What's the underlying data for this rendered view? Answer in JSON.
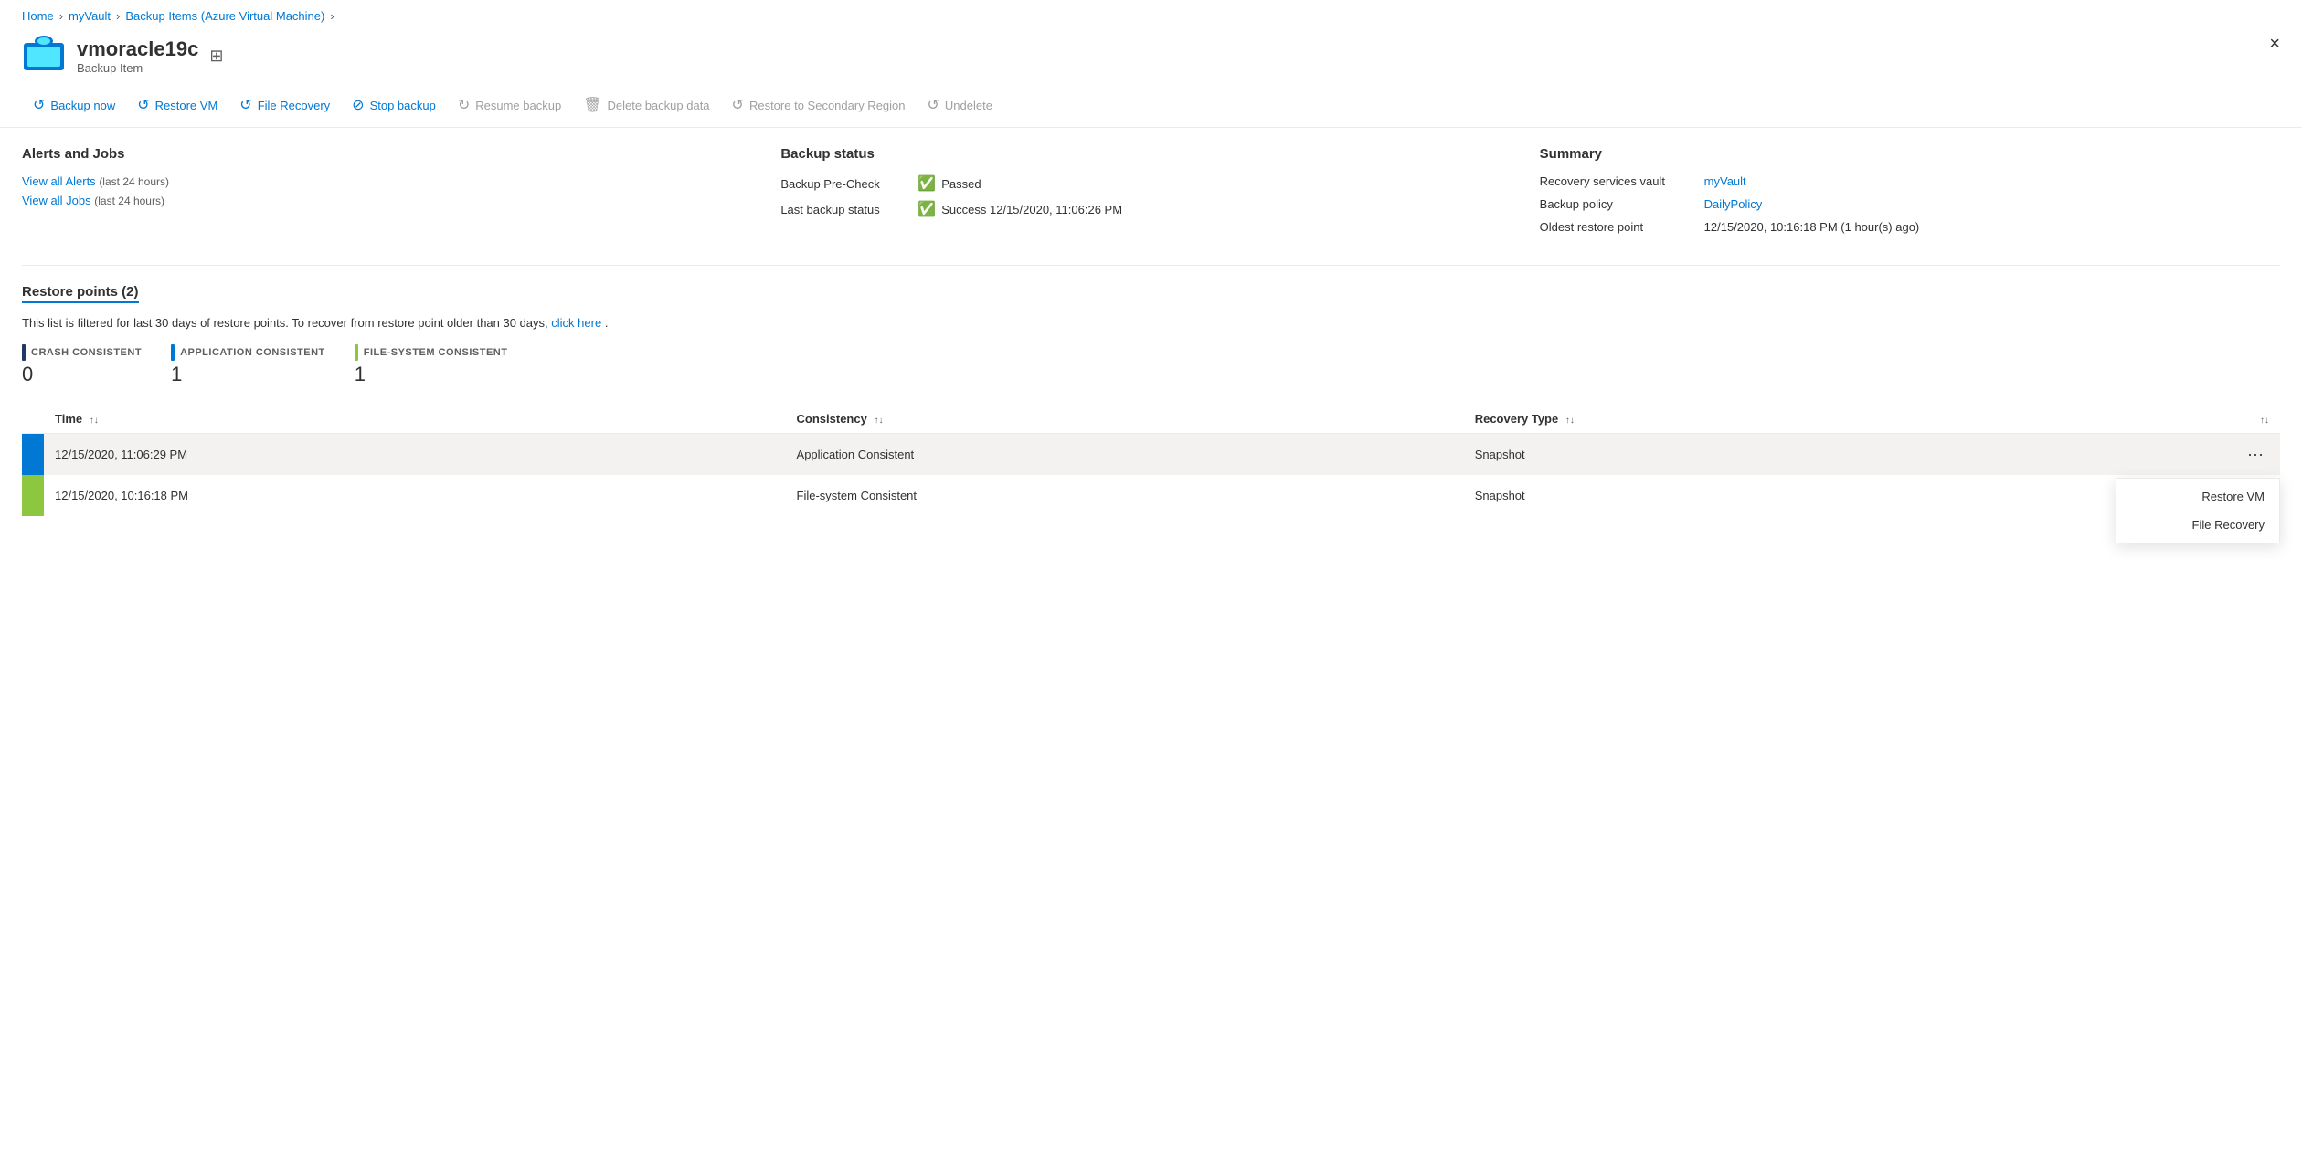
{
  "breadcrumb": {
    "items": [
      "Home",
      "myVault",
      "Backup Items (Azure Virtual Machine)"
    ]
  },
  "header": {
    "vm_name": "vmoracle19c",
    "subtitle": "Backup Item",
    "close_label": "×"
  },
  "toolbar": {
    "buttons": [
      {
        "id": "backup-now",
        "label": "Backup now",
        "icon": "↺",
        "disabled": false
      },
      {
        "id": "restore-vm",
        "label": "Restore VM",
        "icon": "↺",
        "disabled": false
      },
      {
        "id": "file-recovery",
        "label": "File Recovery",
        "icon": "↺",
        "disabled": false
      },
      {
        "id": "stop-backup",
        "label": "Stop backup",
        "icon": "⊘",
        "disabled": false
      },
      {
        "id": "resume-backup",
        "label": "Resume backup",
        "icon": "↻",
        "disabled": true
      },
      {
        "id": "delete-backup-data",
        "label": "Delete backup data",
        "icon": "🗑",
        "disabled": true
      },
      {
        "id": "restore-secondary",
        "label": "Restore to Secondary Region",
        "icon": "↺",
        "disabled": true
      },
      {
        "id": "undelete",
        "label": "Undelete",
        "icon": "↺",
        "disabled": true
      }
    ]
  },
  "alerts_jobs": {
    "title": "Alerts and Jobs",
    "view_alerts_label": "View all Alerts",
    "view_alerts_suffix": "(last 24 hours)",
    "view_jobs_label": "View all Jobs",
    "view_jobs_suffix": "(last 24 hours)"
  },
  "backup_status": {
    "title": "Backup status",
    "pre_check_label": "Backup Pre-Check",
    "pre_check_value": "Passed",
    "last_backup_label": "Last backup status",
    "last_backup_value": "Success 12/15/2020, 11:06:26 PM"
  },
  "summary": {
    "title": "Summary",
    "vault_label": "Recovery services vault",
    "vault_value": "myVault",
    "policy_label": "Backup policy",
    "policy_value": "DailyPolicy",
    "oldest_label": "Oldest restore point",
    "oldest_value": "12/15/2020, 10:16:18 PM (1 hour(s) ago)"
  },
  "restore_points": {
    "title": "Restore points (2)",
    "filter_note_prefix": "This list is filtered for last 30 days of restore points. To recover from restore point older than 30 days,",
    "filter_note_link": "click here",
    "filter_note_suffix": ".",
    "legend": [
      {
        "id": "crash",
        "label": "CRASH CONSISTENT",
        "count": "0",
        "color": "navy"
      },
      {
        "id": "application",
        "label": "APPLICATION CONSISTENT",
        "count": "1",
        "color": "blue"
      },
      {
        "id": "filesystem",
        "label": "FILE-SYSTEM CONSISTENT",
        "count": "1",
        "color": "lime"
      }
    ],
    "table": {
      "headers": [
        {
          "id": "time",
          "label": "Time",
          "sortable": true
        },
        {
          "id": "consistency",
          "label": "Consistency",
          "sortable": true
        },
        {
          "id": "recovery-type",
          "label": "Recovery Type",
          "sortable": true
        },
        {
          "id": "actions",
          "label": "",
          "sortable": true
        }
      ],
      "rows": [
        {
          "id": "row1",
          "time": "12/15/2020, 11:06:29 PM",
          "consistency": "Application Consistent",
          "recovery_type": "Snapshot",
          "indicator": "blue",
          "highlight": true
        },
        {
          "id": "row2",
          "time": "12/15/2020, 10:16:18 PM",
          "consistency": "File-system Consistent",
          "recovery_type": "Snapshot",
          "indicator": "lime",
          "highlight": false
        }
      ]
    }
  },
  "context_menu": {
    "items": [
      {
        "id": "restore-vm-menu",
        "label": "Restore VM"
      },
      {
        "id": "file-recovery-menu",
        "label": "File Recovery"
      }
    ]
  }
}
